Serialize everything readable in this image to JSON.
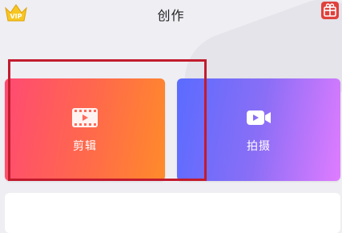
{
  "header": {
    "title": "创作",
    "vip_label": "VIP",
    "vip_icon": "vip-crown-icon",
    "gift_icon": "gift-icon"
  },
  "cards": {
    "edit": {
      "label": "剪辑",
      "icon": "film-strip-icon"
    },
    "shoot": {
      "label": "拍摄",
      "icon": "video-camera-icon"
    }
  },
  "colors": {
    "highlight": "#c21b2d",
    "edit_gradient_start": "#ff4a73",
    "edit_gradient_end": "#ff8b2a",
    "shoot_gradient_start": "#5a6cff",
    "shoot_gradient_end": "#e07cff"
  }
}
